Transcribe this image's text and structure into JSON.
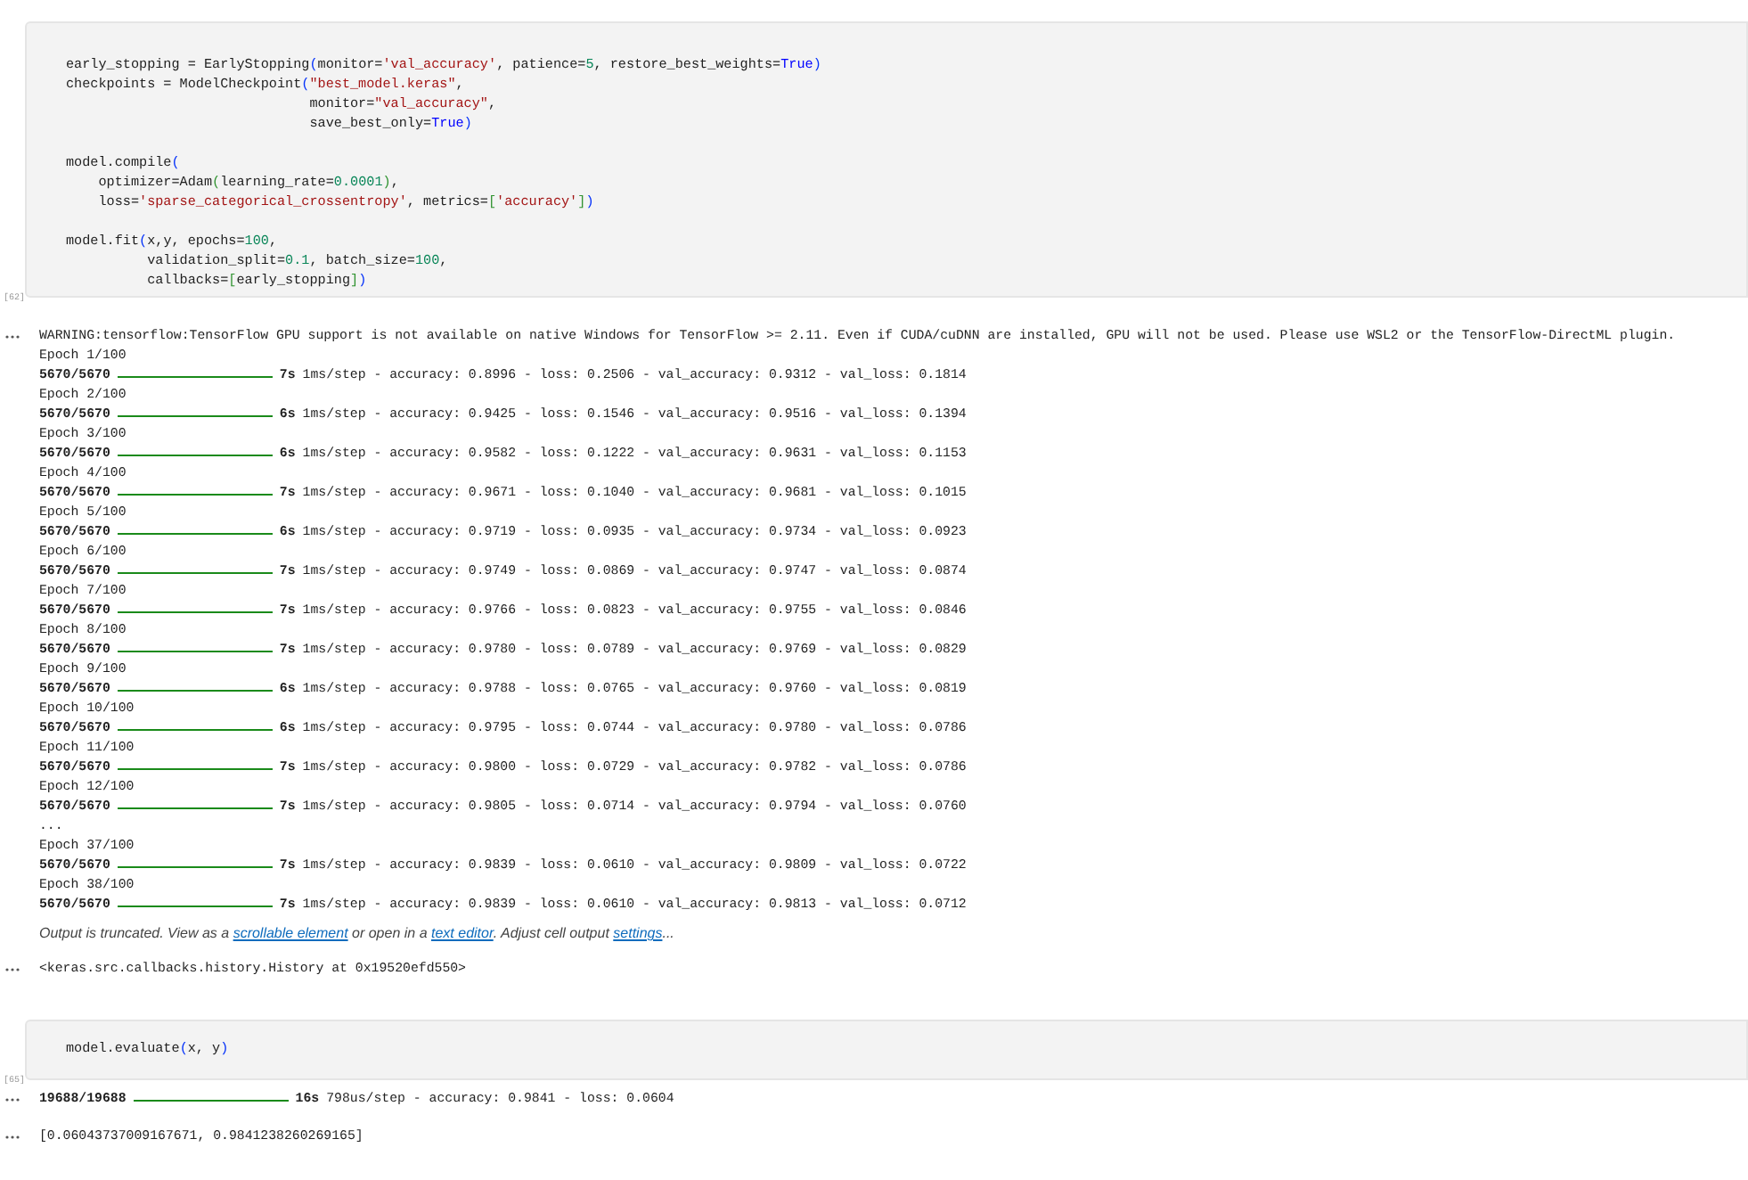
{
  "cells": [
    {
      "execution_count": "[62]",
      "code_blocks": [
        [
          [
            {
              "text": "early_stopping = EarlyStopping",
              "kind": "plain"
            },
            {
              "text": "(",
              "kind": "bracket"
            },
            {
              "text": "monitor=",
              "kind": "plain"
            },
            {
              "text": "'val_accuracy'",
              "kind": "string"
            },
            {
              "text": ", patience=",
              "kind": "plain"
            },
            {
              "text": "5",
              "kind": "number"
            },
            {
              "text": ", restore_best_weights=",
              "kind": "plain"
            },
            {
              "text": "True",
              "kind": "keyword"
            },
            {
              "text": ")",
              "kind": "bracket"
            }
          ],
          [
            {
              "text": "checkpoints = ModelCheckpoint",
              "kind": "plain"
            },
            {
              "text": "(",
              "kind": "bracket"
            },
            {
              "text": "\"best_model.keras\"",
              "kind": "string"
            },
            {
              "text": ",",
              "kind": "plain"
            }
          ],
          [
            {
              "text": "                              monitor=",
              "kind": "plain"
            },
            {
              "text": "\"val_accuracy\"",
              "kind": "string"
            },
            {
              "text": ",",
              "kind": "plain"
            }
          ],
          [
            {
              "text": "                              save_best_only=",
              "kind": "plain"
            },
            {
              "text": "True",
              "kind": "keyword"
            },
            {
              "text": ")",
              "kind": "bracket"
            }
          ]
        ],
        [
          [
            {
              "text": "model.compile",
              "kind": "plain"
            },
            {
              "text": "(",
              "kind": "bracket"
            }
          ],
          [
            {
              "text": "    optimizer=Adam",
              "kind": "plain"
            },
            {
              "text": "(",
              "kind": "bracket2"
            },
            {
              "text": "learning_rate=",
              "kind": "plain"
            },
            {
              "text": "0.0001",
              "kind": "number"
            },
            {
              "text": ")",
              "kind": "bracket2"
            },
            {
              "text": ",",
              "kind": "plain"
            }
          ],
          [
            {
              "text": "    loss=",
              "kind": "plain"
            },
            {
              "text": "'sparse_categorical_crossentropy'",
              "kind": "string"
            },
            {
              "text": ", metrics=",
              "kind": "plain"
            },
            {
              "text": "[",
              "kind": "bracket2"
            },
            {
              "text": "'accuracy'",
              "kind": "string"
            },
            {
              "text": "]",
              "kind": "bracket2"
            },
            {
              "text": ")",
              "kind": "bracket"
            }
          ]
        ],
        [
          [
            {
              "text": "model.fit",
              "kind": "plain"
            },
            {
              "text": "(",
              "kind": "bracket"
            },
            {
              "text": "x,y, epochs=",
              "kind": "plain"
            },
            {
              "text": "100",
              "kind": "number"
            },
            {
              "text": ",",
              "kind": "plain"
            }
          ],
          [
            {
              "text": "          validation_split=",
              "kind": "plain"
            },
            {
              "text": "0.1",
              "kind": "number"
            },
            {
              "text": ", batch_size=",
              "kind": "plain"
            },
            {
              "text": "100",
              "kind": "number"
            },
            {
              "text": ",",
              "kind": "plain"
            }
          ],
          [
            {
              "text": "          callbacks=",
              "kind": "plain"
            },
            {
              "text": "[",
              "kind": "bracket2"
            },
            {
              "text": "early_stopping",
              "kind": "plain"
            },
            {
              "text": "]",
              "kind": "bracket2"
            },
            {
              "text": ")",
              "kind": "bracket"
            }
          ]
        ]
      ],
      "outputs": [
        {
          "kind": "stream",
          "lines": [
            {
              "kind": "text",
              "text": "WARNING:tensorflow:TensorFlow GPU support is not available on native Windows for TensorFlow >= 2.11. Even if CUDA/cuDNN are installed, GPU will not be used. Please use WSL2 or the TensorFlow-DirectML plugin."
            },
            {
              "kind": "text",
              "text": "Epoch 1/100"
            },
            {
              "kind": "progress",
              "step": "5670/5670",
              "time": "7s",
              "detail": "1ms/step - accuracy: 0.8996 - loss: 0.2506 - val_accuracy: 0.9312 - val_loss: 0.1814"
            },
            {
              "kind": "text",
              "text": "Epoch 2/100"
            },
            {
              "kind": "progress",
              "step": "5670/5670",
              "time": "6s",
              "detail": "1ms/step - accuracy: 0.9425 - loss: 0.1546 - val_accuracy: 0.9516 - val_loss: 0.1394"
            },
            {
              "kind": "text",
              "text": "Epoch 3/100"
            },
            {
              "kind": "progress",
              "step": "5670/5670",
              "time": "6s",
              "detail": "1ms/step - accuracy: 0.9582 - loss: 0.1222 - val_accuracy: 0.9631 - val_loss: 0.1153"
            },
            {
              "kind": "text",
              "text": "Epoch 4/100"
            },
            {
              "kind": "progress",
              "step": "5670/5670",
              "time": "7s",
              "detail": "1ms/step - accuracy: 0.9671 - loss: 0.1040 - val_accuracy: 0.9681 - val_loss: 0.1015"
            },
            {
              "kind": "text",
              "text": "Epoch 5/100"
            },
            {
              "kind": "progress",
              "step": "5670/5670",
              "time": "6s",
              "detail": "1ms/step - accuracy: 0.9719 - loss: 0.0935 - val_accuracy: 0.9734 - val_loss: 0.0923"
            },
            {
              "kind": "text",
              "text": "Epoch 6/100"
            },
            {
              "kind": "progress",
              "step": "5670/5670",
              "time": "7s",
              "detail": "1ms/step - accuracy: 0.9749 - loss: 0.0869 - val_accuracy: 0.9747 - val_loss: 0.0874"
            },
            {
              "kind": "text",
              "text": "Epoch 7/100"
            },
            {
              "kind": "progress",
              "step": "5670/5670",
              "time": "7s",
              "detail": "1ms/step - accuracy: 0.9766 - loss: 0.0823 - val_accuracy: 0.9755 - val_loss: 0.0846"
            },
            {
              "kind": "text",
              "text": "Epoch 8/100"
            },
            {
              "kind": "progress",
              "step": "5670/5670",
              "time": "7s",
              "detail": "1ms/step - accuracy: 0.9780 - loss: 0.0789 - val_accuracy: 0.9769 - val_loss: 0.0829"
            },
            {
              "kind": "text",
              "text": "Epoch 9/100"
            },
            {
              "kind": "progress",
              "step": "5670/5670",
              "time": "6s",
              "detail": "1ms/step - accuracy: 0.9788 - loss: 0.0765 - val_accuracy: 0.9760 - val_loss: 0.0819"
            },
            {
              "kind": "text",
              "text": "Epoch 10/100"
            },
            {
              "kind": "progress",
              "step": "5670/5670",
              "time": "6s",
              "detail": "1ms/step - accuracy: 0.9795 - loss: 0.0744 - val_accuracy: 0.9780 - val_loss: 0.0786"
            },
            {
              "kind": "text",
              "text": "Epoch 11/100"
            },
            {
              "kind": "progress",
              "step": "5670/5670",
              "time": "7s",
              "detail": "1ms/step - accuracy: 0.9800 - loss: 0.0729 - val_accuracy: 0.9782 - val_loss: 0.0786"
            },
            {
              "kind": "text",
              "text": "Epoch 12/100"
            },
            {
              "kind": "progress",
              "step": "5670/5670",
              "time": "7s",
              "detail": "1ms/step - accuracy: 0.9805 - loss: 0.0714 - val_accuracy: 0.9794 - val_loss: 0.0760"
            },
            {
              "kind": "text",
              "text": "..."
            },
            {
              "kind": "text",
              "text": "Epoch 37/100"
            },
            {
              "kind": "progress",
              "step": "5670/5670",
              "time": "7s",
              "detail": "1ms/step - accuracy: 0.9839 - loss: 0.0610 - val_accuracy: 0.9809 - val_loss: 0.0722"
            },
            {
              "kind": "text",
              "text": "Epoch 38/100"
            },
            {
              "kind": "progress",
              "step": "5670/5670",
              "time": "7s",
              "detail": "1ms/step - accuracy: 0.9839 - loss: 0.0610 - val_accuracy: 0.9813 - val_loss: 0.0712"
            }
          ],
          "note": [
            {
              "kind": "text",
              "text": "Output is truncated. View as a "
            },
            {
              "kind": "link",
              "text": "scrollable element"
            },
            {
              "kind": "text",
              "text": " or open in a "
            },
            {
              "kind": "link",
              "text": "text editor"
            },
            {
              "kind": "text",
              "text": ". Adjust cell output "
            },
            {
              "kind": "link",
              "text": "settings"
            },
            {
              "kind": "text",
              "text": "..."
            }
          ]
        },
        {
          "kind": "result",
          "lines": [
            {
              "kind": "text",
              "text": "<keras.src.callbacks.history.History at 0x19520efd550>"
            }
          ]
        }
      ]
    },
    {
      "execution_count": "[65]",
      "code_blocks": [
        [
          [
            {
              "text": "model.evaluate",
              "kind": "plain"
            },
            {
              "text": "(",
              "kind": "bracket"
            },
            {
              "text": "x, y",
              "kind": "plain"
            },
            {
              "text": ")",
              "kind": "bracket"
            }
          ]
        ]
      ],
      "outputs": [
        {
          "kind": "stream",
          "lines": [
            {
              "kind": "progress",
              "step": "19688/19688",
              "time": "16s",
              "detail": "798us/step - accuracy: 0.9841 - loss: 0.0604"
            }
          ]
        },
        {
          "kind": "result",
          "lines": [
            {
              "kind": "text",
              "text": "[0.06043737009167671, 0.9841238260269165]"
            }
          ]
        }
      ]
    }
  ]
}
